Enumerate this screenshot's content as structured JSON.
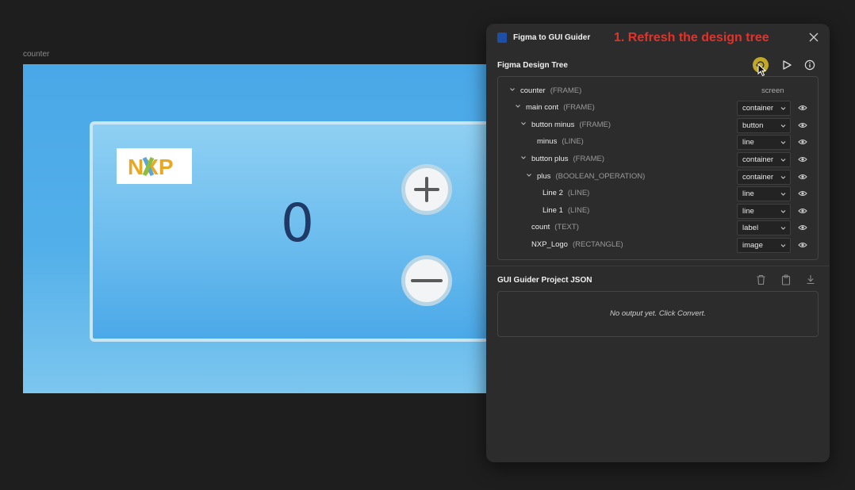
{
  "canvas": {
    "frame_label": "counter",
    "count_value": "0",
    "logo_text": "NXP",
    "colors": {
      "background": "#1e1e1e",
      "frame": "#4aa8e8",
      "count_text": "#1f3a66"
    }
  },
  "panel": {
    "title": "Figma to GUI Guider",
    "hint": "1. Refresh the design tree",
    "hint_color": "#e0332c",
    "design_tree": {
      "title": "Figma Design Tree",
      "rows": [
        {
          "name": "counter",
          "type": "(FRAME)",
          "tag": "screen"
        },
        {
          "name": "main cont",
          "type": "(FRAME)",
          "select": "container"
        },
        {
          "name": "button minus",
          "type": "(FRAME)",
          "select": "button"
        },
        {
          "name": "minus",
          "type": "(LINE)",
          "select": "line"
        },
        {
          "name": "button plus",
          "type": "(FRAME)",
          "select": "container"
        },
        {
          "name": "plus",
          "type": "(BOOLEAN_OPERATION)",
          "select": "container"
        },
        {
          "name": "Line 2",
          "type": "(LINE)",
          "select": "line"
        },
        {
          "name": "Line 1",
          "type": "(LINE)",
          "select": "line"
        },
        {
          "name": "count",
          "type": "(TEXT)",
          "select": "label"
        },
        {
          "name": "NXP_Logo",
          "type": "(RECTANGLE)",
          "select": "image"
        }
      ]
    },
    "project_json": {
      "title": "GUI Guider Project JSON",
      "output_placeholder": "No output yet. Click Convert."
    },
    "icons": [
      "refresh-icon",
      "play-icon",
      "info-icon",
      "trash-icon",
      "clipboard-icon",
      "download-icon",
      "close-icon",
      "eye-icon",
      "chevron-down-icon"
    ]
  }
}
